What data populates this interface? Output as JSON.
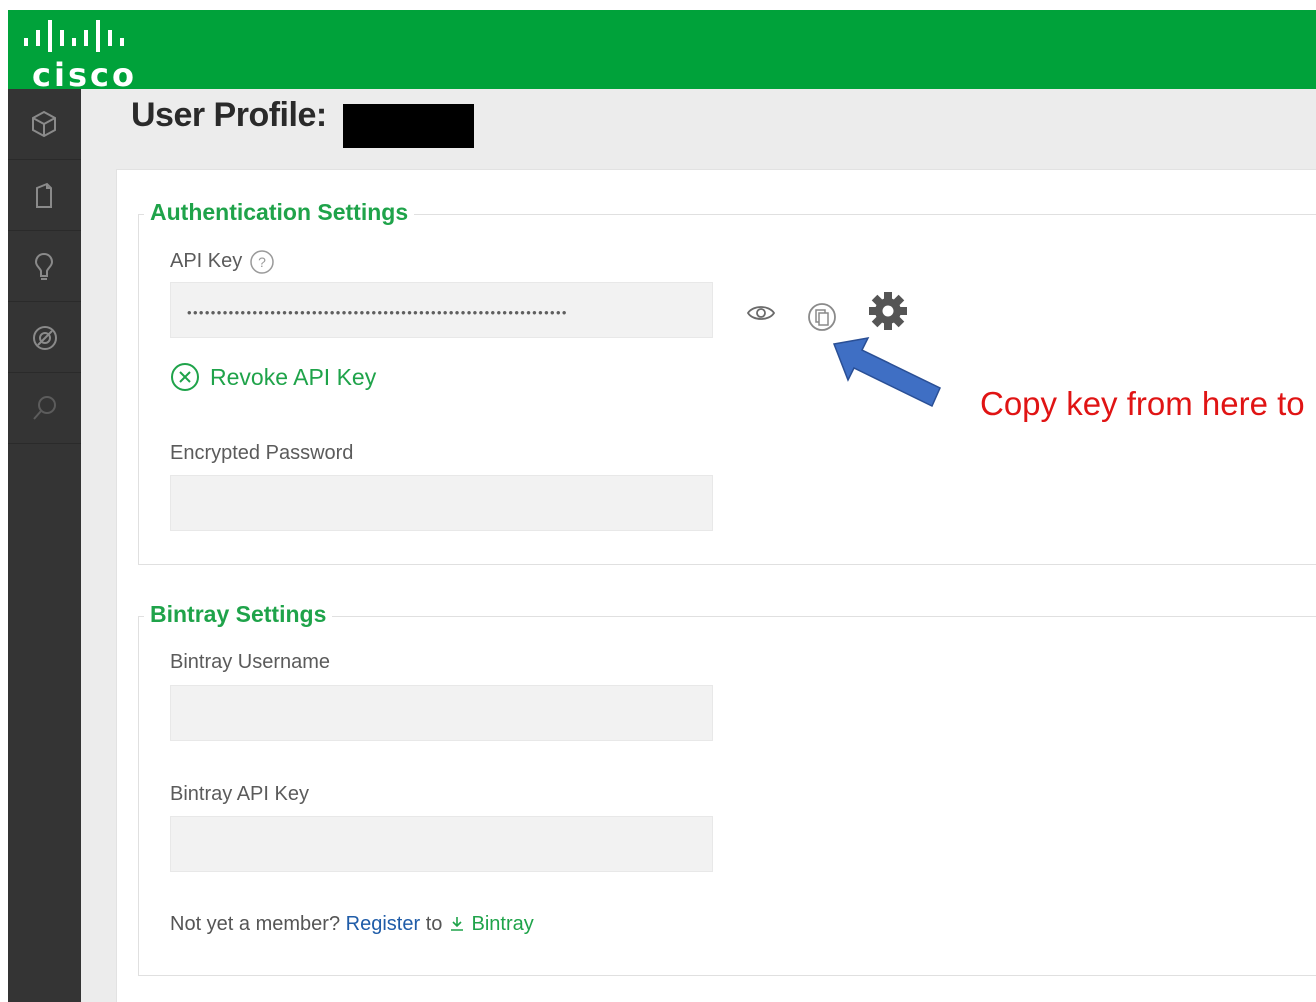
{
  "brand": {
    "logo_text": "cisco",
    "color": "#00a23a"
  },
  "sidebar": {
    "items": [
      {
        "icon": "package-icon"
      },
      {
        "icon": "artifact-icon"
      },
      {
        "icon": "build-icon"
      },
      {
        "icon": "admin-icon"
      },
      {
        "icon": "search-icon"
      }
    ]
  },
  "page": {
    "title": "User Profile:"
  },
  "auth": {
    "legend": "Authentication Settings",
    "api_key_label": "API Key",
    "api_key_value": "••••••••••••••••••••••••••••••••••••••••••••••••••••••••••••••••",
    "revoke_label": "Revoke API Key",
    "encrypted_password_label": "Encrypted Password"
  },
  "annotation": {
    "text": "Copy key from here to"
  },
  "bintray": {
    "legend": "Bintray Settings",
    "username_label": "Bintray Username",
    "api_key_label": "Bintray API Key",
    "member_text": "Not yet a member?",
    "register_link": "Register",
    "to_text": "to",
    "bintray_link": "Bintray"
  }
}
